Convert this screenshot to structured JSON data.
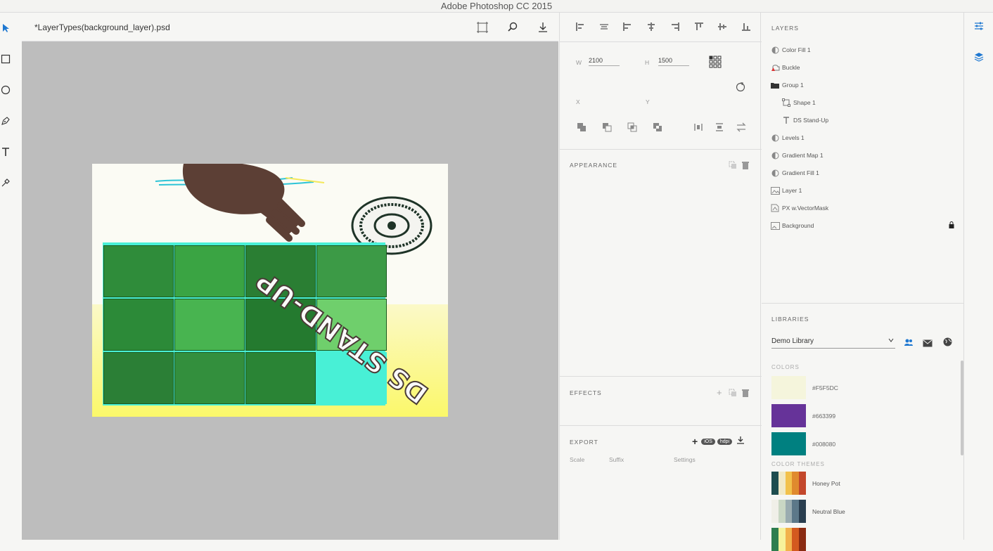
{
  "app": {
    "title": "Adobe Photoshop CC 2015"
  },
  "document": {
    "name": "*LayerTypes(background_layer).psd"
  },
  "artwork": {
    "text": "DS STAND-UP"
  },
  "properties": {
    "w_label": "W",
    "w_value": "2100",
    "h_label": "H",
    "h_value": "1500",
    "x_label": "X",
    "y_label": "Y",
    "appearance": "APPEARANCE",
    "effects": "EFFECTS",
    "export": "EXPORT",
    "export_badges": [
      "iOS",
      "hdpi"
    ],
    "export_cols": [
      "Scale",
      "Suffix",
      "Settings"
    ]
  },
  "layers": {
    "header": "LAYERS",
    "items": [
      {
        "name": "Color Fill 1",
        "icon": "adjustment-icon",
        "indent": 0
      },
      {
        "name": "Buckle",
        "icon": "warning-smartobject-icon",
        "indent": 0
      },
      {
        "name": "Group 1",
        "icon": "folder-icon",
        "indent": 0
      },
      {
        "name": "Shape 1",
        "icon": "shape-icon",
        "indent": 1
      },
      {
        "name": "DS Stand-Up",
        "icon": "text-layer-icon",
        "indent": 1
      },
      {
        "name": "Levels 1",
        "icon": "adjustment-icon",
        "indent": 0
      },
      {
        "name": "Gradient Map 1",
        "icon": "adjustment-icon",
        "indent": 0
      },
      {
        "name": "Gradient Fill 1",
        "icon": "adjustment-icon",
        "indent": 0
      },
      {
        "name": "Layer 1",
        "icon": "pixel-layer-icon",
        "indent": 0
      },
      {
        "name": "PX w.VectorMask",
        "icon": "vector-mask-icon",
        "indent": 0
      },
      {
        "name": "Background",
        "icon": "image-layer-icon",
        "indent": 0,
        "locked": true
      }
    ]
  },
  "libraries": {
    "header": "LIBRARIES",
    "selected": "Demo Library",
    "colors_header": "COLORS",
    "colors": [
      {
        "hex": "#F5F5DC",
        "label": "#F5F5DC"
      },
      {
        "hex": "#663399",
        "label": "#663399"
      },
      {
        "hex": "#008080",
        "label": "#008080"
      }
    ],
    "themes_header": "COLOR THEMES",
    "themes": [
      {
        "name": "Honey Pot",
        "colors": [
          "#1e4d4f",
          "#f1e9c6",
          "#f2c14b",
          "#e08a2e",
          "#c3472b"
        ]
      },
      {
        "name": "Neutral Blue",
        "colors": [
          "#f0efe8",
          "#c9d7c4",
          "#9aacb0",
          "#5c7889",
          "#2a3e4f"
        ]
      },
      {
        "name": "",
        "colors": [
          "#2e7d4f",
          "#f7f29a",
          "#f2b24b",
          "#d45a1f",
          "#8a2b12"
        ]
      }
    ]
  },
  "colors": {
    "accent": "#1f78d1"
  }
}
